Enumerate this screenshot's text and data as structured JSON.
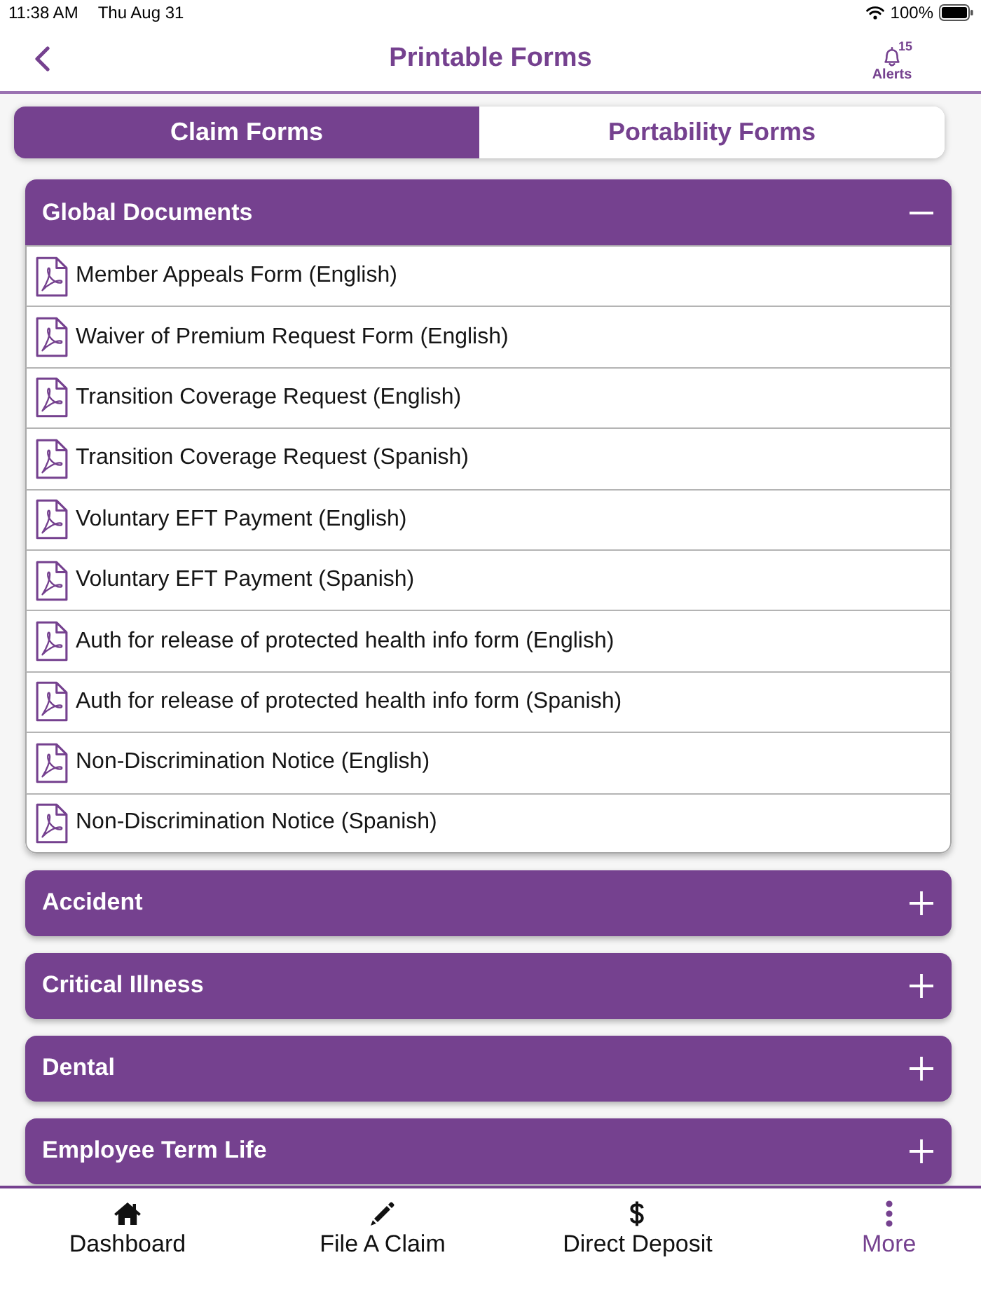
{
  "status_bar": {
    "time": "11:38 AM",
    "date": "Thu Aug 31",
    "battery": "100%"
  },
  "nav": {
    "title": "Printable Forms",
    "alerts_label": "Alerts",
    "alerts_count": "15"
  },
  "tabs": [
    {
      "label": "Claim Forms",
      "selected": true
    },
    {
      "label": "Portability Forms",
      "selected": false
    }
  ],
  "sections": [
    {
      "title": "Global Documents",
      "expanded": true,
      "forms": [
        "Member Appeals Form (English)",
        "Waiver of Premium Request Form (English)",
        "Transition Coverage Request (English)",
        "Transition Coverage Request (Spanish)",
        "Voluntary EFT Payment (English)",
        "Voluntary EFT Payment (Spanish)",
        "Auth for release of protected health info form (English)",
        "Auth for release of protected health info form (Spanish)",
        "Non-Discrimination Notice (English)",
        "Non-Discrimination Notice (Spanish)"
      ]
    },
    {
      "title": "Accident",
      "expanded": false
    },
    {
      "title": "Critical Illness",
      "expanded": false
    },
    {
      "title": "Dental",
      "expanded": false
    },
    {
      "title": "Employee Term Life",
      "expanded": false
    }
  ],
  "tab_bar": [
    {
      "label": "Dashboard",
      "kind": "home",
      "selected": false
    },
    {
      "label": "File A Claim",
      "kind": "pencil",
      "selected": false
    },
    {
      "label": "Direct Deposit",
      "kind": "dollar",
      "selected": false
    },
    {
      "label": "More",
      "kind": "more",
      "selected": true
    }
  ]
}
